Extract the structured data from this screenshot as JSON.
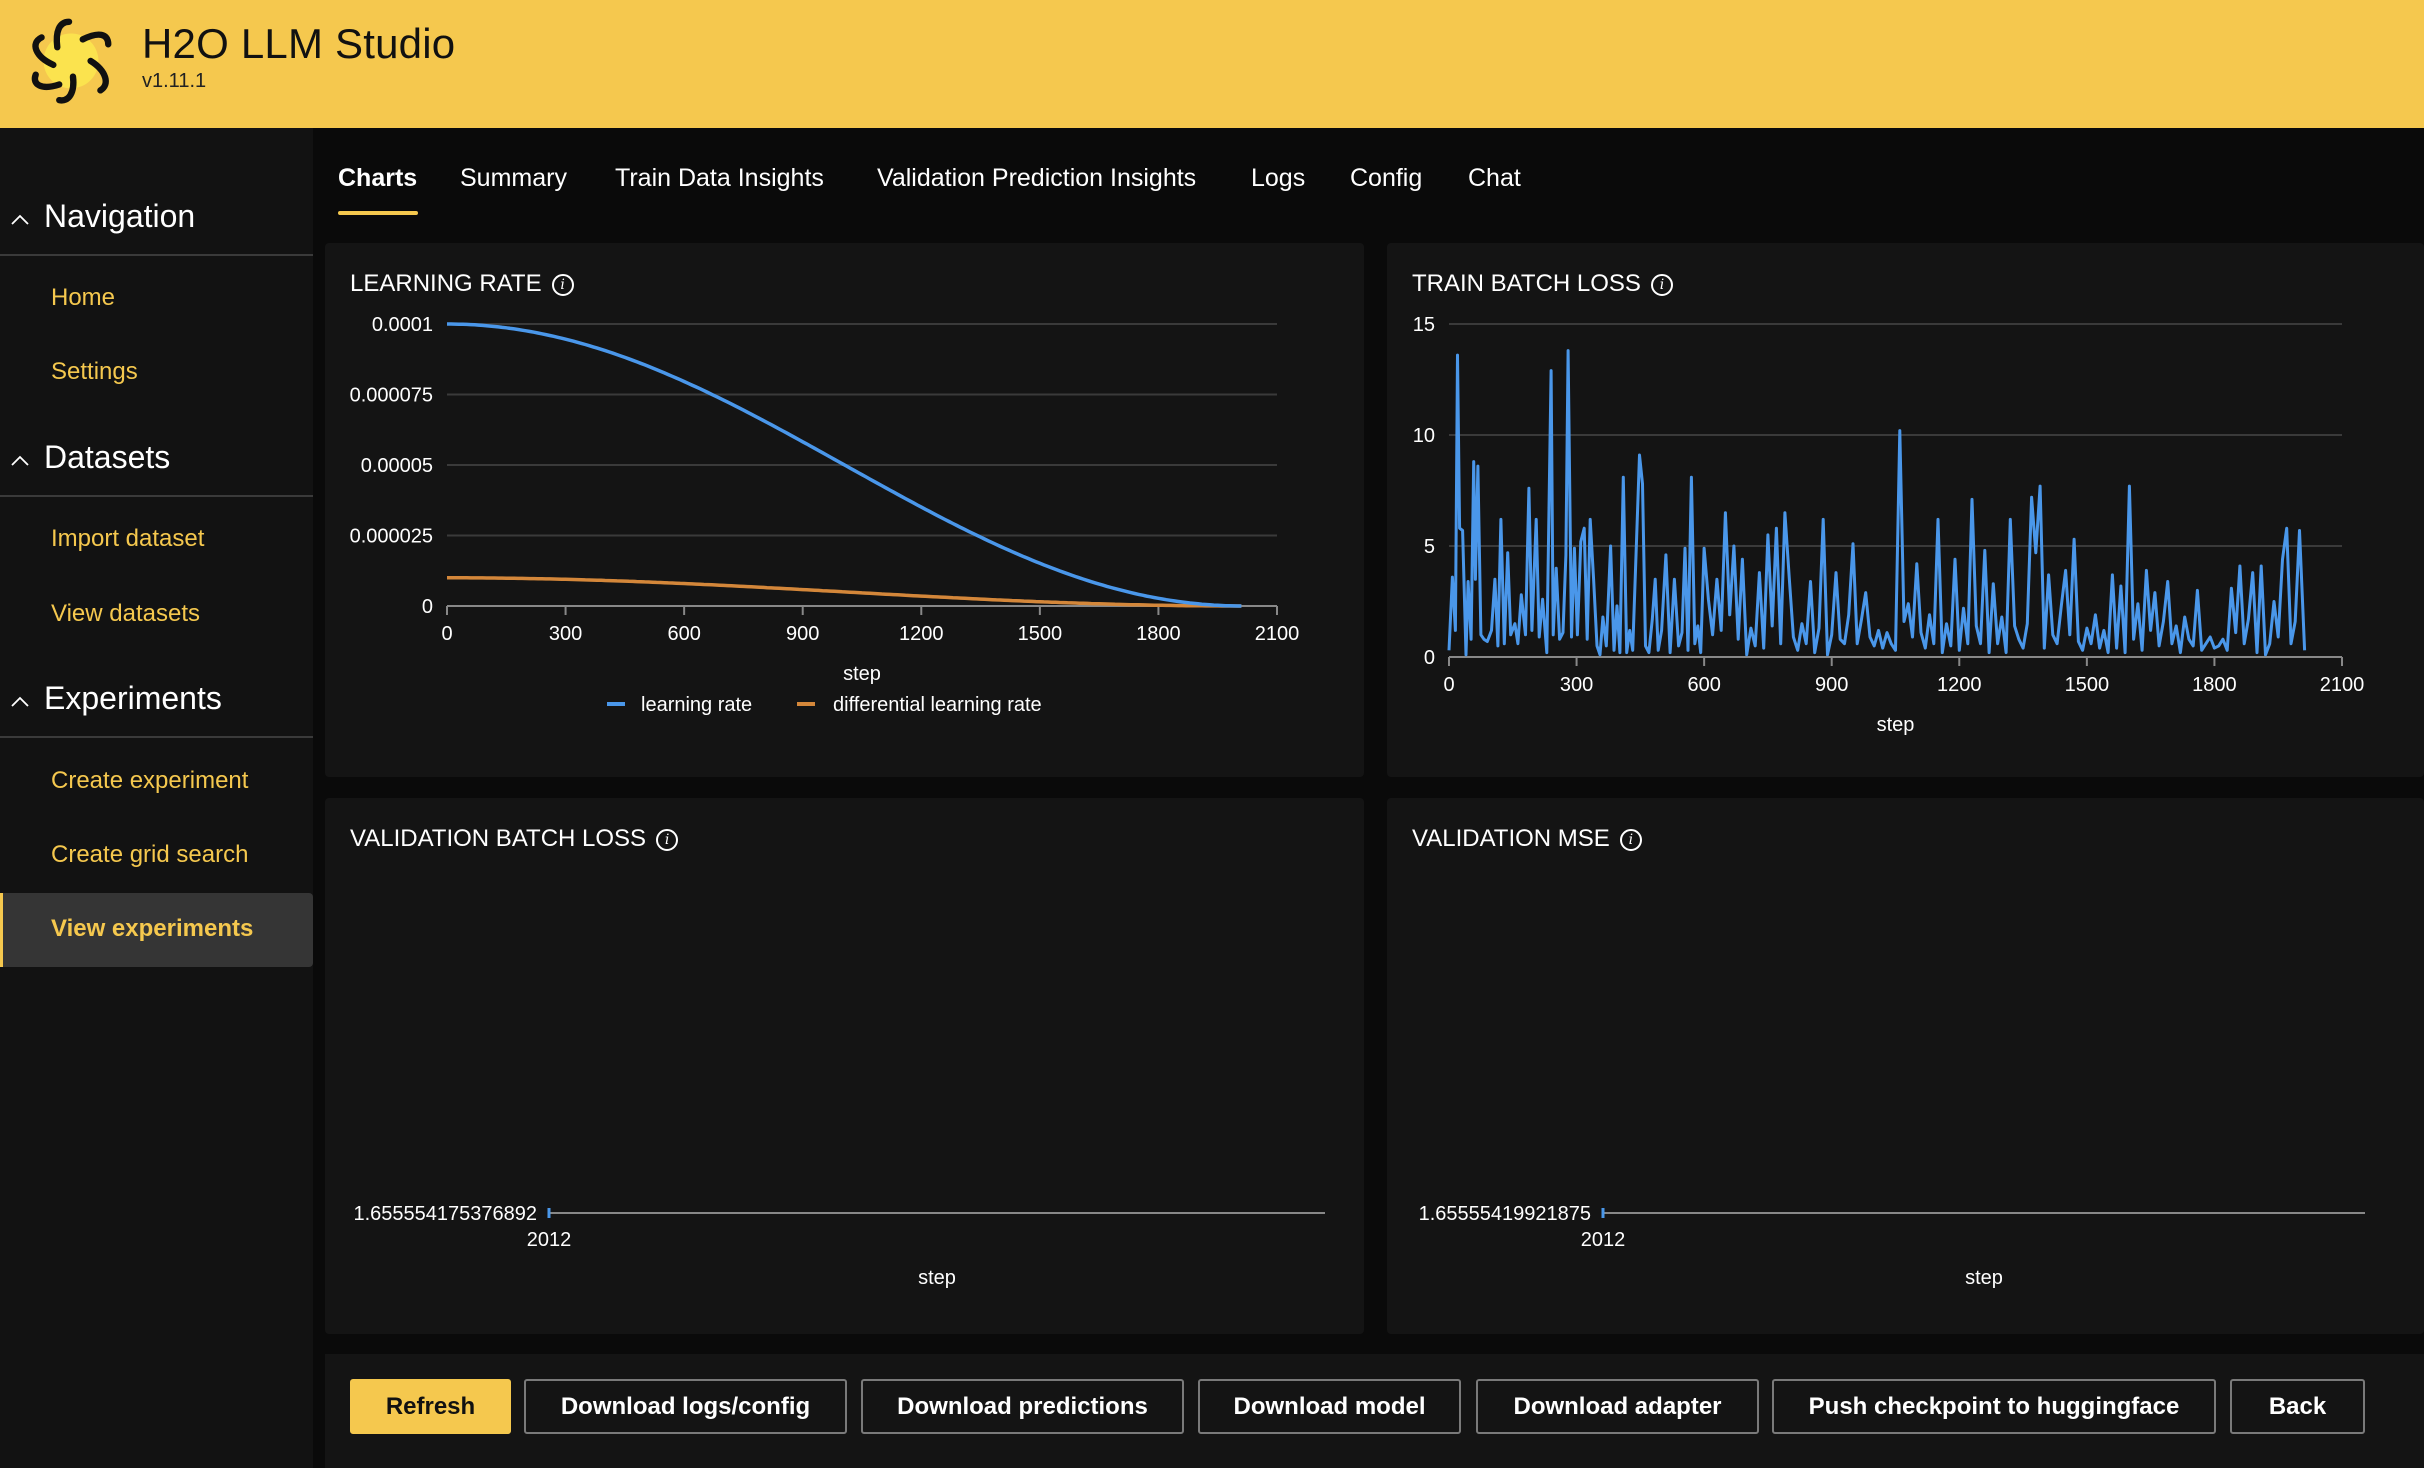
{
  "app": {
    "title": "H2O LLM Studio",
    "version": "v1.11.1",
    "brand_color": "#F5C84E"
  },
  "sidebar": {
    "groups": [
      {
        "label": "Navigation",
        "icon": "chevron-up-icon",
        "items": [
          {
            "label": "Home"
          },
          {
            "label": "Settings"
          }
        ]
      },
      {
        "label": "Datasets",
        "icon": "chevron-up-icon",
        "items": [
          {
            "label": "Import dataset"
          },
          {
            "label": "View datasets"
          }
        ]
      },
      {
        "label": "Experiments",
        "icon": "chevron-up-icon",
        "items": [
          {
            "label": "Create experiment"
          },
          {
            "label": "Create grid search"
          },
          {
            "label": "View experiments",
            "active": true
          }
        ]
      }
    ]
  },
  "tabs": [
    {
      "label": "Charts",
      "active": true
    },
    {
      "label": "Summary"
    },
    {
      "label": "Train Data Insights"
    },
    {
      "label": "Validation Prediction Insights"
    },
    {
      "label": "Logs"
    },
    {
      "label": "Config"
    },
    {
      "label": "Chat"
    }
  ],
  "buttons": {
    "refresh": "Refresh",
    "download_logs": "Download logs/config",
    "download_predictions": "Download predictions",
    "download_model": "Download model",
    "download_adapter": "Download adapter",
    "push_checkpoint": "Push checkpoint to huggingface",
    "back": "Back"
  },
  "chart_data": [
    {
      "id": "learning_rate",
      "type": "line",
      "title": "LEARNING RATE",
      "xlabel": "step",
      "ylabel": "",
      "xlim": [
        0,
        2100
      ],
      "ylim": [
        0,
        0.0001
      ],
      "x_ticks": [
        "0",
        "300",
        "600",
        "900",
        "1200",
        "1500",
        "1800",
        "2100"
      ],
      "y_ticks": [
        "0",
        "0.000025",
        "0.00005",
        "0.000075",
        "0.0001"
      ],
      "y_tick_values": [
        0,
        2.5e-05,
        5e-05,
        7.5e-05,
        0.0001
      ],
      "grid": true,
      "legend": "bottom",
      "series": [
        {
          "name": "learning rate",
          "color": "#4A97EA",
          "schedule": "cosine",
          "start": 0.0001,
          "end": 0,
          "x_end": 2012
        },
        {
          "name": "differential learning rate",
          "color": "#D4873A",
          "schedule": "cosine",
          "start": 1e-05,
          "end": 0,
          "x_end": 2012
        }
      ]
    },
    {
      "id": "train_batch_loss",
      "type": "line",
      "title": "TRAIN BATCH LOSS",
      "xlabel": "step",
      "ylabel": "",
      "xlim": [
        0,
        2100
      ],
      "ylim": [
        0,
        15
      ],
      "x_ticks": [
        "0",
        "300",
        "600",
        "900",
        "1200",
        "1500",
        "1800",
        "2100"
      ],
      "y_ticks": [
        "0",
        "5",
        "10",
        "15"
      ],
      "y_tick_values": [
        0,
        5,
        10,
        15
      ],
      "grid": true,
      "series": [
        {
          "name": "train batch loss",
          "color": "#4A97EA",
          "x": [
            0,
            8,
            15,
            20,
            25,
            32,
            40,
            45,
            52,
            58,
            62,
            68,
            75,
            82,
            90,
            100,
            108,
            115,
            122,
            130,
            138,
            145,
            155,
            162,
            170,
            180,
            188,
            195,
            205,
            212,
            220,
            230,
            240,
            245,
            252,
            260,
            268,
            275,
            280,
            288,
            295,
            302,
            310,
            318,
            325,
            332,
            340,
            348,
            355,
            362,
            370,
            380,
            388,
            395,
            402,
            410,
            418,
            425,
            432,
            440,
            448,
            455,
            462,
            470,
            478,
            485,
            492,
            500,
            510,
            520,
            530,
            540,
            548,
            555,
            562,
            570,
            578,
            585,
            592,
            600,
            610,
            620,
            630,
            640,
            650,
            660,
            670,
            680,
            690,
            700,
            710,
            720,
            730,
            740,
            750,
            760,
            770,
            780,
            790,
            800,
            810,
            820,
            830,
            840,
            850,
            860,
            870,
            880,
            890,
            900,
            910,
            920,
            930,
            940,
            950,
            960,
            970,
            980,
            990,
            1000,
            1010,
            1020,
            1030,
            1040,
            1050,
            1060,
            1070,
            1080,
            1090,
            1100,
            1110,
            1120,
            1130,
            1140,
            1150,
            1160,
            1170,
            1180,
            1190,
            1200,
            1210,
            1220,
            1230,
            1240,
            1250,
            1260,
            1270,
            1280,
            1290,
            1300,
            1310,
            1320,
            1330,
            1340,
            1350,
            1360,
            1370,
            1380,
            1390,
            1400,
            1410,
            1420,
            1430,
            1440,
            1450,
            1460,
            1470,
            1480,
            1490,
            1500,
            1510,
            1520,
            1530,
            1540,
            1550,
            1560,
            1570,
            1580,
            1590,
            1600,
            1610,
            1620,
            1630,
            1640,
            1650,
            1660,
            1670,
            1680,
            1690,
            1700,
            1710,
            1720,
            1730,
            1740,
            1750,
            1760,
            1770,
            1780,
            1790,
            1800,
            1810,
            1820,
            1830,
            1840,
            1850,
            1860,
            1870,
            1880,
            1890,
            1900,
            1910,
            1920,
            1930,
            1940,
            1950,
            1960,
            1970,
            1980,
            1990,
            2000,
            2012
          ],
          "y": [
            0.3,
            3.6,
            1.2,
            13.6,
            5.8,
            5.7,
            0.1,
            3.4,
            0.8,
            8.8,
            3.5,
            8.6,
            1.0,
            0.8,
            0.7,
            1.2,
            3.5,
            0.5,
            6.2,
            0.6,
            4.7,
            1.0,
            1.5,
            0.6,
            2.8,
            1.0,
            7.6,
            1.2,
            6.2,
            0.9,
            2.6,
            0.2,
            12.9,
            1.0,
            4.0,
            0.8,
            1.1,
            4.6,
            13.8,
            0.9,
            4.9,
            1.0,
            5.2,
            5.8,
            0.8,
            6.2,
            3.5,
            0.5,
            0.1,
            1.8,
            0.5,
            5.0,
            0.3,
            2.3,
            0.2,
            8.1,
            0.2,
            1.2,
            0.3,
            4.7,
            9.1,
            7.8,
            0.5,
            0.2,
            1.7,
            3.5,
            0.3,
            1.2,
            4.6,
            0.2,
            3.5,
            0.5,
            1.1,
            4.9,
            0.3,
            8.1,
            0.6,
            1.4,
            0.2,
            4.9,
            2.6,
            1.0,
            3.5,
            1.2,
            6.5,
            1.9,
            5.0,
            0.8,
            4.4,
            0.1,
            1.3,
            0.5,
            3.8,
            0.4,
            5.5,
            1.4,
            5.8,
            0.6,
            6.5,
            3.6,
            0.9,
            0.3,
            1.5,
            0.6,
            3.4,
            0.2,
            1.3,
            6.2,
            0.1,
            1.0,
            3.8,
            0.8,
            0.6,
            1.9,
            5.1,
            0.6,
            1.7,
            2.9,
            0.9,
            0.5,
            1.2,
            0.4,
            1.1,
            0.6,
            0.3,
            10.2,
            1.6,
            2.4,
            0.9,
            4.2,
            1.1,
            0.4,
            1.9,
            0.6,
            6.2,
            0.2,
            1.5,
            0.5,
            4.4,
            0.3,
            2.2,
            0.6,
            7.1,
            1.4,
            0.6,
            4.8,
            0.2,
            3.3,
            0.6,
            1.8,
            0.2,
            6.2,
            1.4,
            0.8,
            0.4,
            1.5,
            7.2,
            4.7,
            7.7,
            0.4,
            3.7,
            1.0,
            0.6,
            2.3,
            3.9,
            1.0,
            5.3,
            0.7,
            0.3,
            1.3,
            0.6,
            1.9,
            0.4,
            1.2,
            0.2,
            3.7,
            0.4,
            3.2,
            0.2,
            7.7,
            0.8,
            2.4,
            0.3,
            3.9,
            1.2,
            2.9,
            0.5,
            1.6,
            3.4,
            0.6,
            1.4,
            0.2,
            1.8,
            0.8,
            0.5,
            3.0,
            0.3,
            0.6,
            0.9,
            0.4,
            0.5,
            0.8,
            0.3,
            3.1,
            1.1,
            4.1,
            0.6,
            1.7,
            3.8,
            0.2,
            4.1,
            0.1,
            0.6,
            2.5,
            0.9,
            4.4,
            5.8,
            0.6,
            1.6,
            5.7,
            0.3,
            5.3,
            0.4,
            3.6,
            0.5
          ]
        }
      ]
    },
    {
      "id": "validation_batch_loss",
      "type": "line",
      "title": "VALIDATION BATCH LOSS",
      "xlabel": "step",
      "x_ticks": [
        "2012"
      ],
      "y_ticks": [
        "1.655554175376892"
      ],
      "series": [
        {
          "name": "validation batch loss",
          "color": "#4A97EA",
          "x": [
            2012
          ],
          "y": [
            1.655554175376892
          ]
        }
      ]
    },
    {
      "id": "validation_mse",
      "type": "line",
      "title": "VALIDATION MSE",
      "xlabel": "step",
      "x_ticks": [
        "2012"
      ],
      "y_ticks": [
        "1.65555419921875"
      ],
      "series": [
        {
          "name": "validation mse",
          "color": "#4A97EA",
          "x": [
            2012
          ],
          "y": [
            1.65555419921875
          ]
        }
      ]
    }
  ]
}
